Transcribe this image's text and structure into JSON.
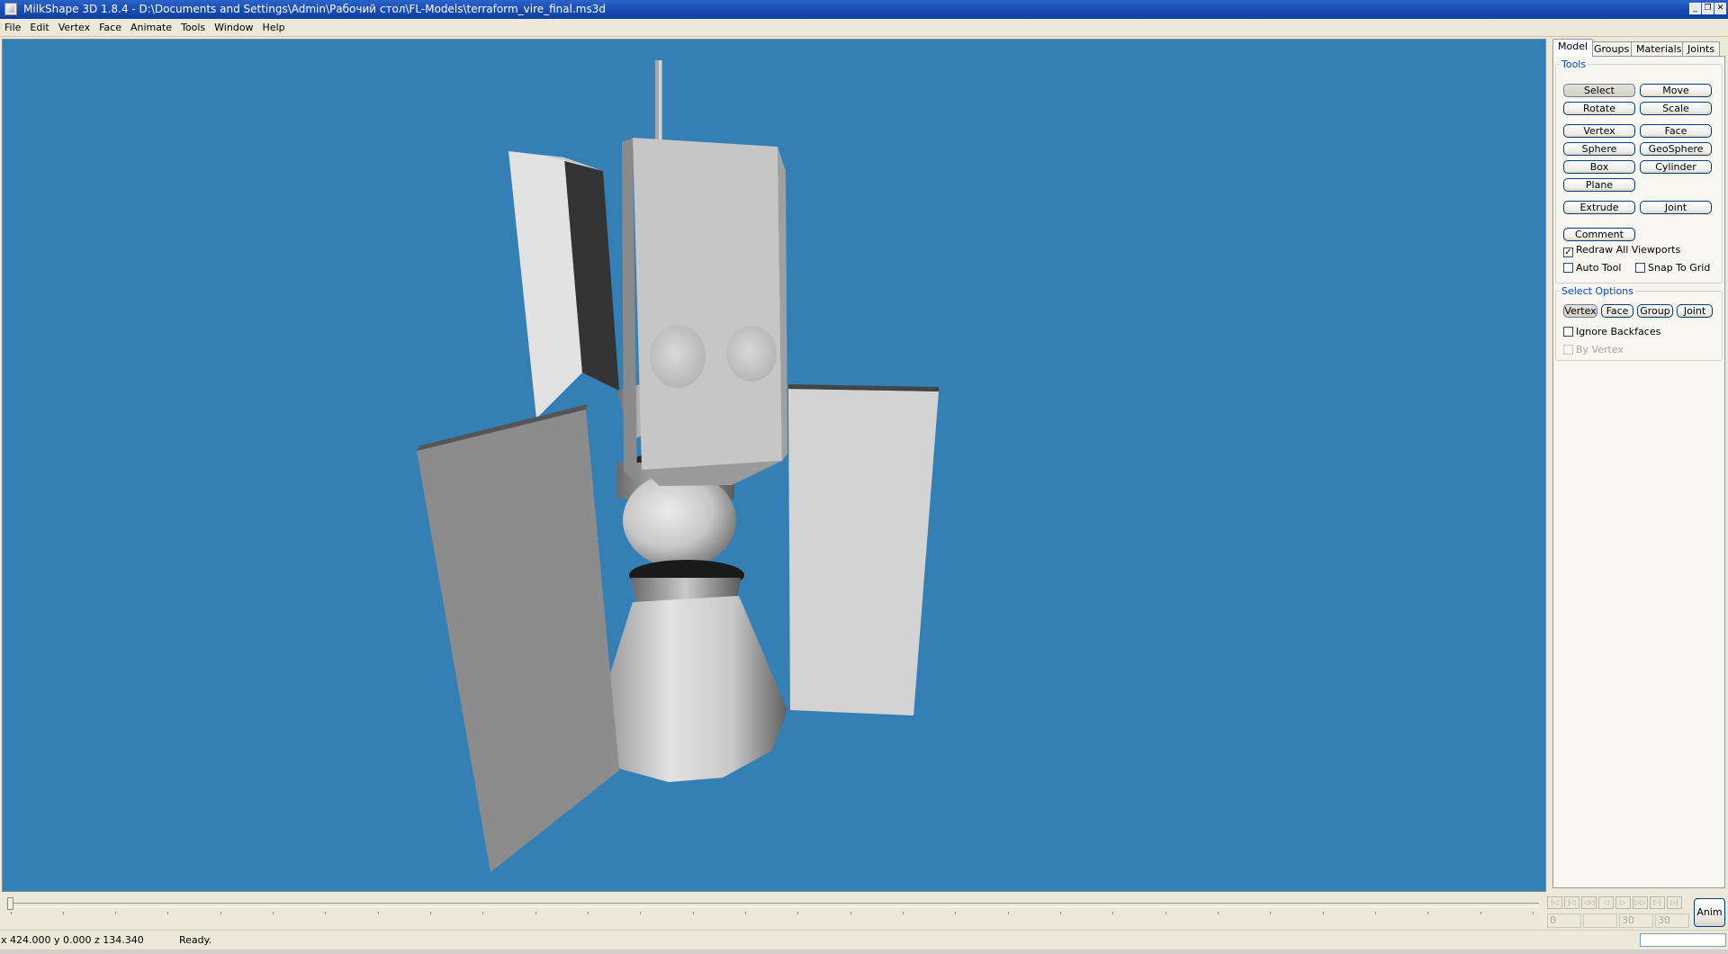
{
  "window": {
    "title": "MilkShape 3D 1.8.4 - D:\\Documents and Settings\\Admin\\Рабочий стол\\FL-Models\\terraform_vire_final.ms3d",
    "buttons": {
      "minimize": "_",
      "restore": "❐",
      "close": "✕"
    }
  },
  "menu": [
    "File",
    "Edit",
    "Vertex",
    "Face",
    "Animate",
    "Tools",
    "Window",
    "Help"
  ],
  "viewport": {
    "background": "#3480b5"
  },
  "panel": {
    "tabs": [
      "Model",
      "Groups",
      "Materials",
      "Joints"
    ],
    "active_tab": "Model",
    "tools": {
      "legend": "Tools",
      "select": "Select",
      "move": "Move",
      "rotate": "Rotate",
      "scale": "Scale",
      "vertex": "Vertex",
      "face": "Face",
      "sphere": "Sphere",
      "geosphere": "GeoSphere",
      "box": "Box",
      "cylinder": "Cylinder",
      "plane": "Plane",
      "extrude": "Extrude",
      "joint": "Joint",
      "comment": "Comment",
      "redraw_all": "Redraw All Viewports",
      "redraw_all_checked": true,
      "auto_tool": "Auto Tool",
      "auto_tool_checked": false,
      "snap_to_grid": "Snap To Grid",
      "snap_to_grid_checked": false
    },
    "select_options": {
      "legend": "Select Options",
      "vertex": "Vertex",
      "face": "Face",
      "group": "Group",
      "joint": "Joint",
      "ignore_backfaces": "Ignore Backfaces",
      "ignore_backfaces_checked": false,
      "by_vertex": "By Vertex",
      "by_vertex_checked": false
    }
  },
  "anim": {
    "start_frame": "0",
    "current_frame": "",
    "end_frame": "30",
    "total_frames": "30",
    "button": "Anim"
  },
  "status": {
    "coords": "x 424.000 y 0.000 z 134.340",
    "message": "Ready."
  }
}
